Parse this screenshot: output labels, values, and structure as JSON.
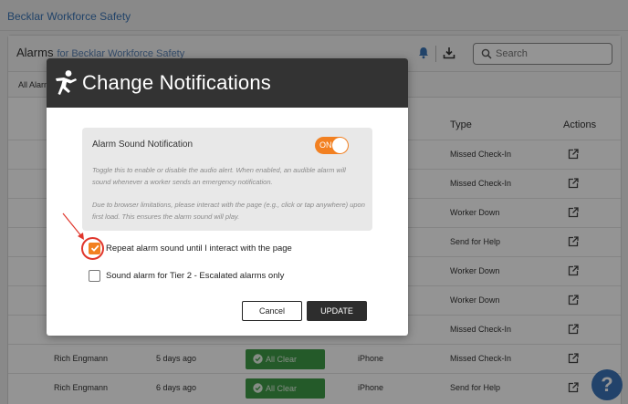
{
  "app": {
    "brand": "Becklar Workforce Safety"
  },
  "panel": {
    "title": "Alarms",
    "subtitle": "for Becklar Workforce Safety",
    "search_placeholder": "Search",
    "filter_tab": "All Alarm",
    "columns": {
      "type": "Type",
      "actions": "Actions"
    }
  },
  "rows": [
    {
      "type": "Missed Check-In"
    },
    {
      "type": "Missed Check-In"
    },
    {
      "type": "Worker Down"
    },
    {
      "type": "Send for Help"
    },
    {
      "type": "Worker Down"
    },
    {
      "type": "Worker Down"
    },
    {
      "type": "Missed Check-In"
    },
    {
      "user": "Rich Engmann",
      "time": "5 days ago",
      "status": "All Clear",
      "device": "iPhone",
      "type": "Missed Check-In"
    },
    {
      "user": "Rich Engmann",
      "time": "6 days ago",
      "status": "All Clear",
      "device": "iPhone",
      "type": "Send for Help"
    }
  ],
  "help": {
    "label": "?"
  },
  "modal": {
    "title": "Change Notifications",
    "card_title": "Alarm Sound Notification",
    "toggle_label": "ON",
    "toggle_on": true,
    "desc1": "Toggle this to enable or disable the audio alert. When enabled, an audible alarm will sound whenever a worker sends an emergency notification.",
    "desc2": "Due to browser limitations, please interact with the page (e.g., click or tap anywhere) upon first load. This ensures the alarm sound will play.",
    "opt_repeat": "Repeat alarm sound until I interact with the page",
    "opt_repeat_checked": true,
    "opt_tier2": "Sound alarm for Tier 2 - Escalated alarms only",
    "opt_tier2_checked": false,
    "cancel": "Cancel",
    "update": "UPDATE"
  },
  "colors": {
    "accent": "#f28021",
    "header": "#333333",
    "success": "#3f9c47",
    "annotation": "#e0362c",
    "link": "#3a74b5"
  }
}
